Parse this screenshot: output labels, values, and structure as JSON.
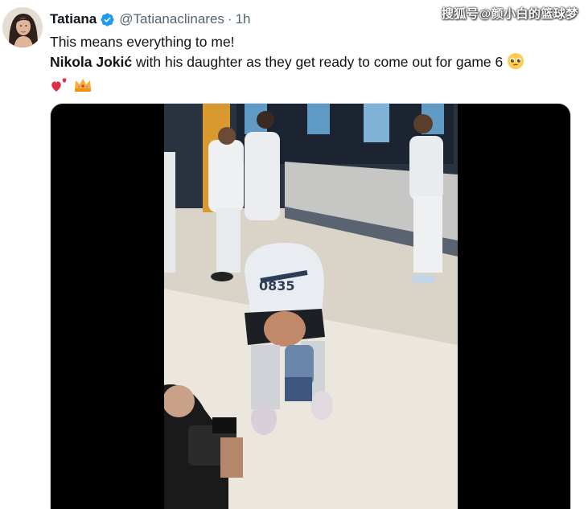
{
  "author": {
    "display_name": "Tatiana",
    "handle": "@Tatianaclinares",
    "separator": "·",
    "time": "1h",
    "avatar_icon": "avatar-photo",
    "verified_icon": "verified-badge-icon"
  },
  "watermark": "搜狐号@颜小白的篮球梦",
  "tweet": {
    "line1": "This means everything to me!",
    "line2_bold": "Nikola Jokić",
    "line2_rest": " with his daughter as they get ready to come out for game 6",
    "emojis": [
      "pleading-face-emoji",
      "heart-exclamation-emoji",
      "crown-emoji"
    ]
  },
  "media": {
    "type": "video",
    "jersey_number": "0835"
  },
  "colors": {
    "text": "#0f1419",
    "secondary": "#536471",
    "verified": "#1d9bf0",
    "border": "#cfd9de"
  }
}
